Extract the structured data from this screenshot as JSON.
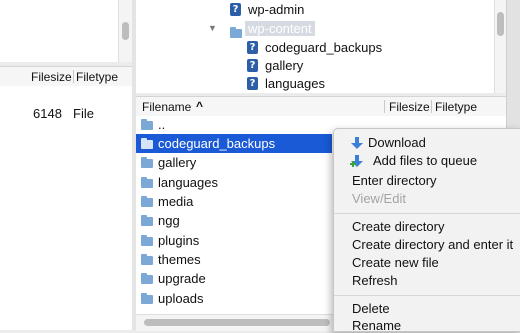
{
  "local_pane": {
    "columns": {
      "filesize": "Filesize",
      "filetype": "Filetype"
    },
    "rows": [
      {
        "size": "6148",
        "type": "File"
      }
    ]
  },
  "remote_tree": {
    "items": [
      {
        "label": "wp-admin",
        "icon": "question-icon"
      },
      {
        "label": "wp-content",
        "icon": "folder-icon"
      },
      {
        "label": "codeguard_backups",
        "icon": "question-icon"
      },
      {
        "label": "gallery",
        "icon": "question-icon"
      },
      {
        "label": "languages",
        "icon": "question-icon"
      }
    ]
  },
  "remote_list": {
    "columns": {
      "filename": "Filename",
      "sort_indicator": "^",
      "filesize": "Filesize",
      "filetype": "Filetype"
    },
    "rows": [
      {
        "name": "..",
        "selected": false
      },
      {
        "name": "codeguard_backups",
        "selected": true
      },
      {
        "name": "gallery",
        "selected": false
      },
      {
        "name": "languages",
        "selected": false
      },
      {
        "name": "media",
        "selected": false
      },
      {
        "name": "ngg",
        "selected": false
      },
      {
        "name": "plugins",
        "selected": false
      },
      {
        "name": "themes",
        "selected": false
      },
      {
        "name": "upgrade",
        "selected": false
      },
      {
        "name": "uploads",
        "selected": false
      }
    ]
  },
  "context_menu": {
    "download": "Download",
    "add_to_queue": "Add files to queue",
    "enter_directory": "Enter directory",
    "view_edit": "View/Edit",
    "create_directory": "Create directory",
    "create_directory_enter": "Create directory and enter it",
    "create_new_file": "Create new file",
    "refresh": "Refresh",
    "delete": "Delete",
    "rename": "Rename"
  },
  "colors": {
    "selection": "#1a5ad6",
    "folder": "#7ca8d8",
    "question_icon": "#2c5fa8"
  }
}
